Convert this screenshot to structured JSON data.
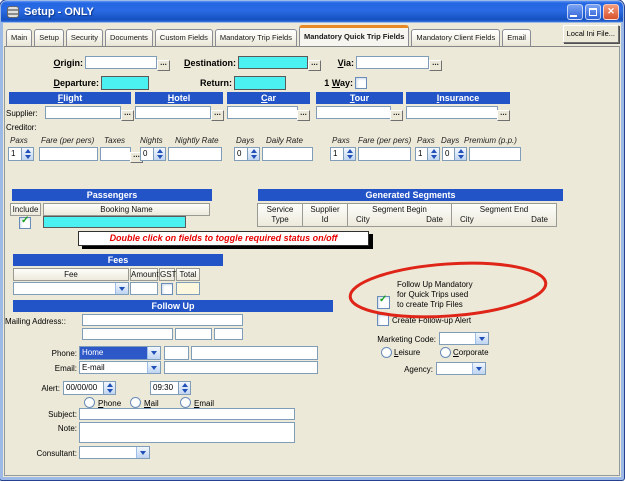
{
  "window": {
    "title": "Setup - ONLY",
    "icon": "database-icon"
  },
  "tabs": {
    "items": [
      "Main",
      "Setup",
      "Security",
      "Documents",
      "Custom Fields",
      "Mandatory Trip Fields",
      "Mandatory Quick Trip Fields",
      "Mandatory Client Fields",
      "Email"
    ],
    "active": "Mandatory Quick Trip Fields",
    "side_button_label": "Local Ini File..."
  },
  "icons": {
    "browse_button": "...",
    "check": "✓",
    "close": "✕"
  },
  "trip": {
    "origin_label": "Origin:",
    "destination_label": "Destination:",
    "via_label": "Via:",
    "departure_label": "Departure:",
    "return_label": "Return:",
    "one_way_prefix": "1 ",
    "one_way_word": "Way:",
    "origin_value": "",
    "destination_value": "",
    "via_value": "",
    "departure_value": "",
    "return_value": ""
  },
  "services": {
    "supplier_label": "Supplier:",
    "creditor_label": "Creditor:",
    "flight": {
      "header": "Flight",
      "paxs_label": "Paxs",
      "paxs_value": "1",
      "fare_label": "Fare (per pers)",
      "taxes_label": "Taxes"
    },
    "hotel": {
      "header": "Hotel",
      "nights_label": "Nights",
      "nights_value": "0",
      "rate_label": "Nightly Rate"
    },
    "car": {
      "header": "Car",
      "days_label": "Days",
      "days_value": "0",
      "rate_label": "Daily Rate"
    },
    "tour": {
      "header": "Tour",
      "paxs_label": "Paxs",
      "paxs_value": "1",
      "fare_label": "Fare (per pers)"
    },
    "insurance": {
      "header": "Insurance",
      "paxs_label": "Paxs",
      "paxs_value": "1",
      "days_label": "Days",
      "days_value": "0",
      "premium_label": "Premium (p.p.)"
    }
  },
  "passengers": {
    "header": "Passengers",
    "include_col": "Include",
    "booking_name_col": "Booking Name",
    "include_checked": true,
    "booking_name_value": ""
  },
  "generated_segments": {
    "header": "Generated Segments",
    "col_service_l1": "Service",
    "col_service_l2": "Type",
    "col_supplier_l1": "Supplier",
    "col_supplier_l2": "Id",
    "col_begin": "Segment Begin",
    "col_end": "Segment End",
    "sub_city": "City",
    "sub_date": "Date"
  },
  "notice": "Double click on fields to toggle required status on/off",
  "fees": {
    "header": "Fees",
    "fee_col": "Fee",
    "amount_col": "Amount",
    "gst_col": "GST",
    "total_col": "Total",
    "fee_value": "",
    "amount_value": "",
    "gst_checked": false,
    "total_value": ""
  },
  "follow_up": {
    "header": "Follow Up",
    "mailing_address_label": "Mailing Address::",
    "phone_label": "Phone:",
    "phone_type_value": "Home",
    "email_label": "Email:",
    "email_type_value": "E-mail",
    "alert_label": "Alert:",
    "alert_date_value": "00/00/00",
    "alert_time_value": "09:30",
    "radio_phone": "Phone",
    "radio_mail": "Mail",
    "radio_email": "Email",
    "subject_label": "Subject:",
    "note_label": "Note:",
    "consultant_label": "Consultant:",
    "subject_value": "",
    "note_value": "",
    "consultant_value": ""
  },
  "options": {
    "mandatory_line1": "Follow Up Mandatory",
    "mandatory_line2": "for Quick Trips used",
    "mandatory_line3": "to create Trip Files",
    "mandatory_checked": true,
    "create_alert_label": "Create Follow-up Alert",
    "create_alert_checked": false,
    "marketing_code_label": "Marketing Code:",
    "marketing_code_value": "",
    "leisure_label": "Leisure",
    "corporate_label": "Corporate",
    "agency_label": "Agency:",
    "agency_value": ""
  },
  "colors": {
    "section_header_blue": "#2254C8",
    "required_field_cyan": "#4BF0F0",
    "notice_text_red": "#E80000",
    "annotation_ellipse_red": "#DF2418",
    "active_tab_orange": "#E78A26",
    "titlebar_blue": "#2467E2",
    "selection_blue": "#2E58C8"
  }
}
